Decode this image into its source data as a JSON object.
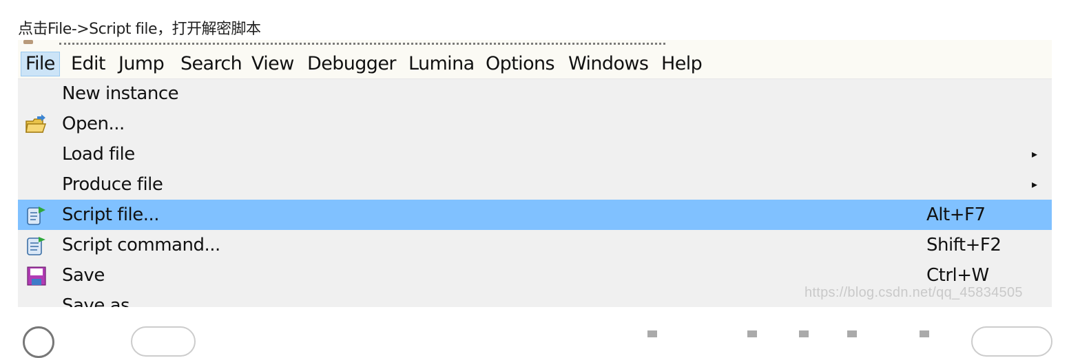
{
  "caption": "点击File->Script file，打开解密脚本",
  "menubar": {
    "items": [
      "File",
      "Edit",
      "Jump",
      "Search",
      "View",
      "Debugger",
      "Lumina",
      "Options",
      "Windows",
      "Help"
    ]
  },
  "file_menu": {
    "items": [
      {
        "label": "New instance",
        "shortcut": "",
        "submenu": false,
        "icon": "none"
      },
      {
        "label": "Open...",
        "shortcut": "",
        "submenu": false,
        "icon": "open-folder-icon"
      },
      {
        "label": "Load file",
        "shortcut": "",
        "submenu": true,
        "icon": "none"
      },
      {
        "label": "Produce file",
        "shortcut": "",
        "submenu": true,
        "icon": "none"
      },
      {
        "label": "Script file...",
        "shortcut": "Alt+F7",
        "submenu": false,
        "icon": "script-file-icon",
        "highlighted": true
      },
      {
        "label": "Script command...",
        "shortcut": "Shift+F2",
        "submenu": false,
        "icon": "script-command-icon"
      },
      {
        "label": "Save",
        "shortcut": "Ctrl+W",
        "submenu": false,
        "icon": "save-icon"
      },
      {
        "label": "Save as...",
        "shortcut": "",
        "submenu": false,
        "icon": "none"
      }
    ]
  },
  "watermark": "https://blog.csdn.net/qq_45834505",
  "colors": {
    "highlight": "#80c1ff",
    "active_menu": "#cce4f7",
    "menu_bg": "#f0f0f0",
    "menubar_bg": "#fbfaf4"
  }
}
